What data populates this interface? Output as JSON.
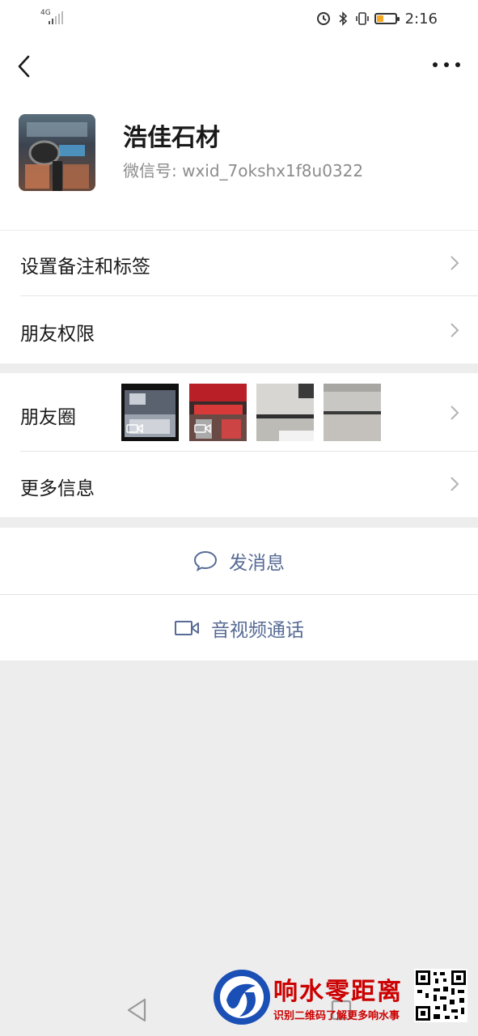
{
  "status_bar": {
    "network": "4G",
    "time": "2:16",
    "battery_level": 0.35
  },
  "profile": {
    "name": "浩佳石材",
    "wechat_id_label": "微信号:",
    "wechat_id": "wxid_7okshx1f8u0322"
  },
  "menu": {
    "remark_tags": "设置备注和标签",
    "friend_permissions": "朋友权限",
    "moments": "朋友圈",
    "more_info": "更多信息"
  },
  "actions": {
    "send_message": "发消息",
    "av_call": "音视频通话"
  },
  "watermark": {
    "title": "响水零距离",
    "subtitle": "识别二维码了解更多响水事"
  },
  "colors": {
    "link": "#576b95",
    "background": "#ededed",
    "watermark": "#cc0000"
  }
}
